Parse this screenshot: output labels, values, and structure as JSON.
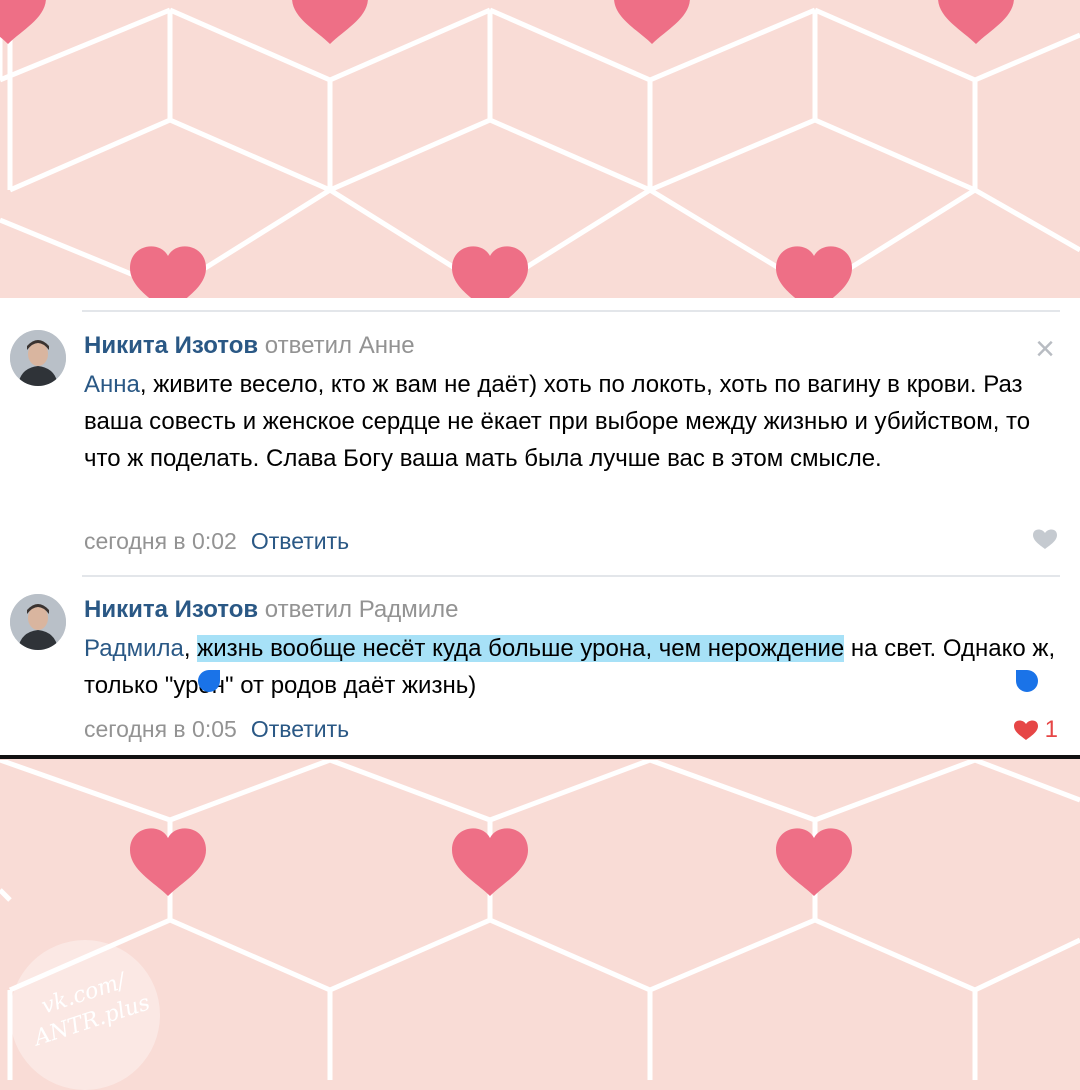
{
  "comments": [
    {
      "author": "Никита Изотов",
      "reply_to": "ответил Анне",
      "mention": "Анна",
      "text": ", живите весело, кто ж вам не даёт) хоть по локоть, хоть по вагину в крови. Раз ваша совесть и женское сердце не ёкает при выборе между жизнью и убийством, то что ж поделать. Слава Богу ваша мать была лучше вас в этом смысле.",
      "date": "сегодня в 0:02",
      "reply_label": "Ответить",
      "close_glyph": "×",
      "liked": false
    },
    {
      "author": "Никита Изотов",
      "reply_to": "ответил Радмиле",
      "mention": "Радмила",
      "text_before": ", ",
      "text_selected": "жизнь вообще несёт куда больше урона, чем нерождение",
      "text_after": " на свет. Однако ж, только \"урон\" от родов даёт жизнь)",
      "date": "сегодня в 0:05",
      "reply_label": "Ответить",
      "likes": "1",
      "liked": true
    }
  ],
  "watermark": {
    "line1": "vk.com/",
    "line2": "ANTR.plus"
  },
  "colors": {
    "background_pink": "#f9dcd6",
    "heart": "#ee6f86",
    "link_blue": "#2a5885",
    "selection": "#a7e1f7",
    "like_red": "#e64646"
  },
  "icons": {
    "close": "close-icon",
    "like_empty": "heart-outline-icon",
    "like_filled": "heart-filled-icon",
    "avatar": "user-avatar"
  }
}
